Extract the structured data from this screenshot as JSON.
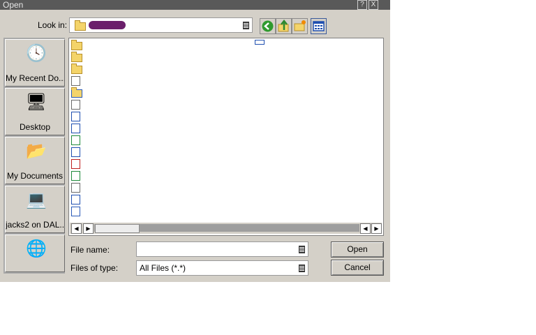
{
  "window": {
    "title": "Open",
    "help_btn": "?",
    "close_btn": "X"
  },
  "look_in": {
    "label": "Look in:",
    "value": ""
  },
  "toolbar": {
    "back_icon": "back-arrow-icon",
    "up_icon": "up-folder-icon",
    "new_icon": "new-folder-icon",
    "view_icon": "view-menu-icon"
  },
  "places": [
    {
      "label": "My Recent Do...",
      "icon": "recent-documents-icon"
    },
    {
      "label": "Desktop",
      "icon": "desktop-icon"
    },
    {
      "label": "My Documents",
      "icon": "my-documents-icon"
    },
    {
      "label": "jacks2 on DAL...",
      "icon": "network-drive-icon"
    },
    {
      "label": "",
      "icon": "network-places-icon"
    }
  ],
  "files": [
    {
      "type": "folder",
      "name": ""
    },
    {
      "type": "folder",
      "name": ""
    },
    {
      "type": "folder",
      "name": ""
    },
    {
      "type": "text",
      "name": ""
    },
    {
      "type": "folder-network",
      "name": ""
    },
    {
      "type": "text",
      "name": ""
    },
    {
      "type": "word",
      "name": ""
    },
    {
      "type": "word",
      "name": ""
    },
    {
      "type": "excel",
      "name": ""
    },
    {
      "type": "word",
      "name": ""
    },
    {
      "type": "pdf",
      "name": ""
    },
    {
      "type": "excel",
      "name": ""
    },
    {
      "type": "text",
      "name": ""
    },
    {
      "type": "word",
      "name": ""
    },
    {
      "type": "generic",
      "name": ""
    }
  ],
  "file_name": {
    "label": "File name:",
    "value": ""
  },
  "files_of_type": {
    "label": "Files of type:",
    "value": "All Files (*.*)"
  },
  "buttons": {
    "open": "Open",
    "cancel": "Cancel"
  },
  "colors": {
    "dialog_bg": "#d4d0c8",
    "titlebar": "#595959",
    "places_bg": "#a8a8a8"
  }
}
